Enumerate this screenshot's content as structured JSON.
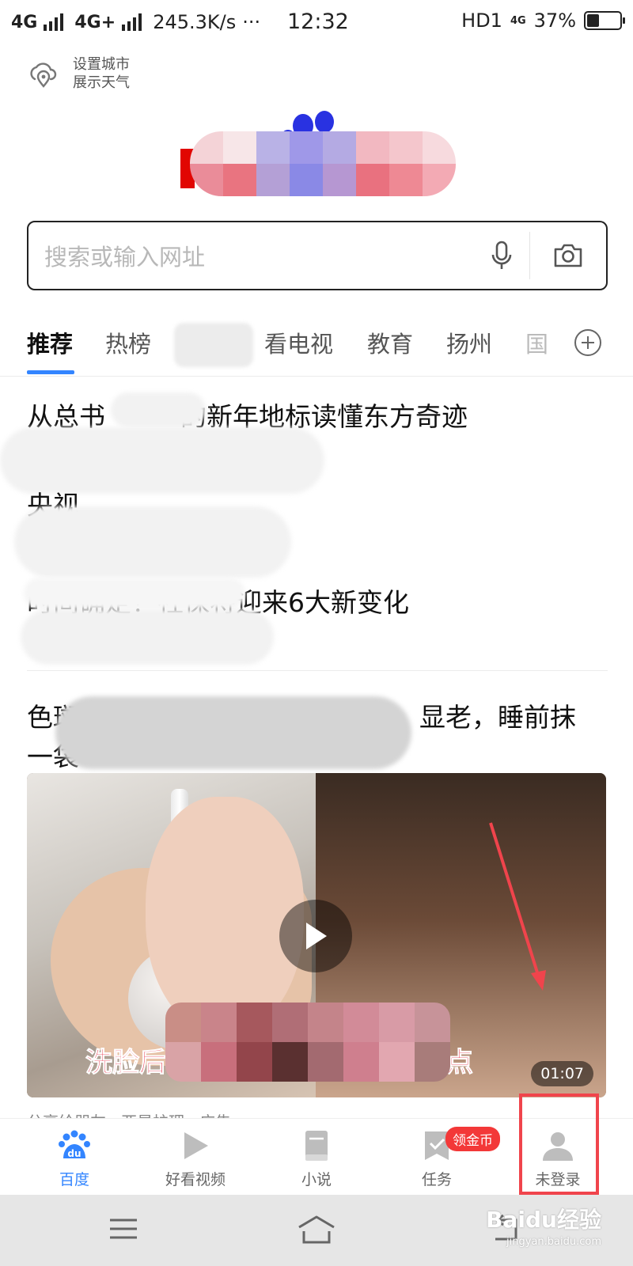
{
  "status_bar": {
    "net1": "4G",
    "net2": "4G+",
    "speed": "245.3K/s",
    "dots": "···",
    "time": "12:32",
    "hd": "HD1",
    "net_small": "4G",
    "battery": "37%"
  },
  "weather": {
    "icon": "cloud-location-icon",
    "line1": "设置城市",
    "line2": "展示天气"
  },
  "search": {
    "placeholder": "搜索或输入网址",
    "mic_icon": "microphone-icon",
    "camera_icon": "camera-icon"
  },
  "tabs": {
    "items": [
      "推荐",
      "热榜",
      "看电视",
      "教育",
      "扬州",
      "国"
    ],
    "active_index": 0,
    "add_icon": "plus-circle-icon"
  },
  "feed": {
    "headline1": "从总书记眼里的新年地标读懂东方奇迹",
    "headline1_visible": "从总书",
    "headline1_tail": "的新年地标读懂东方奇迹",
    "headline2_visible": "央视",
    "headline3_head": "时间确定！社保将迎来6大新变化",
    "headline4_head": "色斑",
    "headline4_tail": "显老，睡前抹",
    "headline4_line2": "一袋"
  },
  "video": {
    "caption": "洗脸后用它淡化斑点",
    "caption_left": "洗脸后",
    "caption_right": "淡化斑点",
    "duration": "01:07",
    "play_icon": "play-icon"
  },
  "ad_meta": "分享给朋友 · 亚星护理 · 广告",
  "bottom_nav": {
    "items": [
      {
        "label": "百度",
        "icon": "baidu-paw-icon"
      },
      {
        "label": "好看视频",
        "icon": "play-triangle-icon"
      },
      {
        "label": "小说",
        "icon": "book-icon"
      },
      {
        "label": "任务",
        "icon": "bookmark-check-icon"
      },
      {
        "label": "未登录",
        "icon": "user-icon"
      }
    ],
    "coin_badge": "领金币",
    "active_color": "#3385ff"
  },
  "system_nav": {
    "menu_icon": "menu-icon",
    "home_icon": "home-icon",
    "back_icon": "back-icon"
  },
  "watermark": {
    "text": "Bai",
    "text2": "du经验",
    "url": "jingyan.baidu.com"
  },
  "colors": {
    "accent": "#3385ff",
    "annotation": "#f0444c",
    "badge": "#f33838"
  }
}
